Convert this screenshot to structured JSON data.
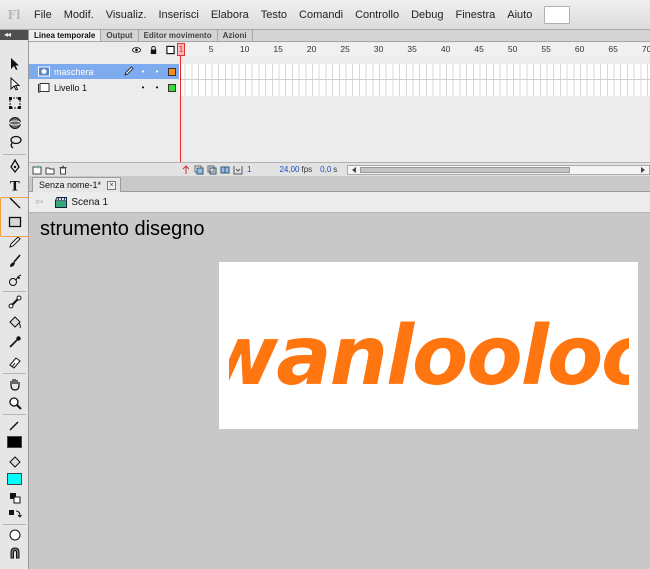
{
  "app": {
    "logo_text": "Fl"
  },
  "menu": [
    "File",
    "Modif.",
    "Visualiz.",
    "Inserisci",
    "Elabora",
    "Testo",
    "Comandi",
    "Controllo",
    "Debug",
    "Finestra",
    "Aiuto"
  ],
  "toolbar": {
    "collapse_label": "◂◂",
    "tools": [
      "selection-tool",
      "subselection-tool",
      "free-transform-tool",
      "3d-rotation-tool",
      "lasso-tool",
      "pen-tool",
      "text-tool",
      "line-tool",
      "rectangle-tool",
      "pencil-tool",
      "brush-tool",
      "deco-tool",
      "bone-tool",
      "paint-bucket-tool",
      "eyedropper-tool",
      "eraser-tool",
      "hand-tool",
      "zoom-tool",
      "stroke-color",
      "fill-color",
      "swap-colors",
      "object-drawing",
      "snap-to-objects"
    ],
    "stroke_color": "#000000",
    "fill_color": "#00ffff"
  },
  "timeline": {
    "tabs": [
      "Linea temporale",
      "Output",
      "Editor movimento",
      "Azioni"
    ],
    "active_tab": 0,
    "layers": [
      {
        "name": "maschera",
        "selected": true,
        "color": "#ff8a1c"
      },
      {
        "name": "Livello 1",
        "selected": false,
        "color": "#33dd33"
      }
    ],
    "frame_numbers": [
      "1",
      "5",
      "10",
      "15",
      "20",
      "25",
      "30",
      "35",
      "40",
      "45",
      "50",
      "55",
      "60",
      "65",
      "70"
    ],
    "current_frame": "1",
    "fps_value": "24,00",
    "fps_label": "fps",
    "time_value": "0,0",
    "time_label": "s",
    "footer_frame": "1"
  },
  "document": {
    "tab_title": "Senza nome-1*",
    "close_glyph": "×",
    "scene_label": "Scena 1",
    "back_glyph": "⇦"
  },
  "annotation": "strumento disegno",
  "stage": {
    "logo_text": "wanlooloo",
    "logo_color": "#ff7510",
    "background": "#ffffff"
  }
}
